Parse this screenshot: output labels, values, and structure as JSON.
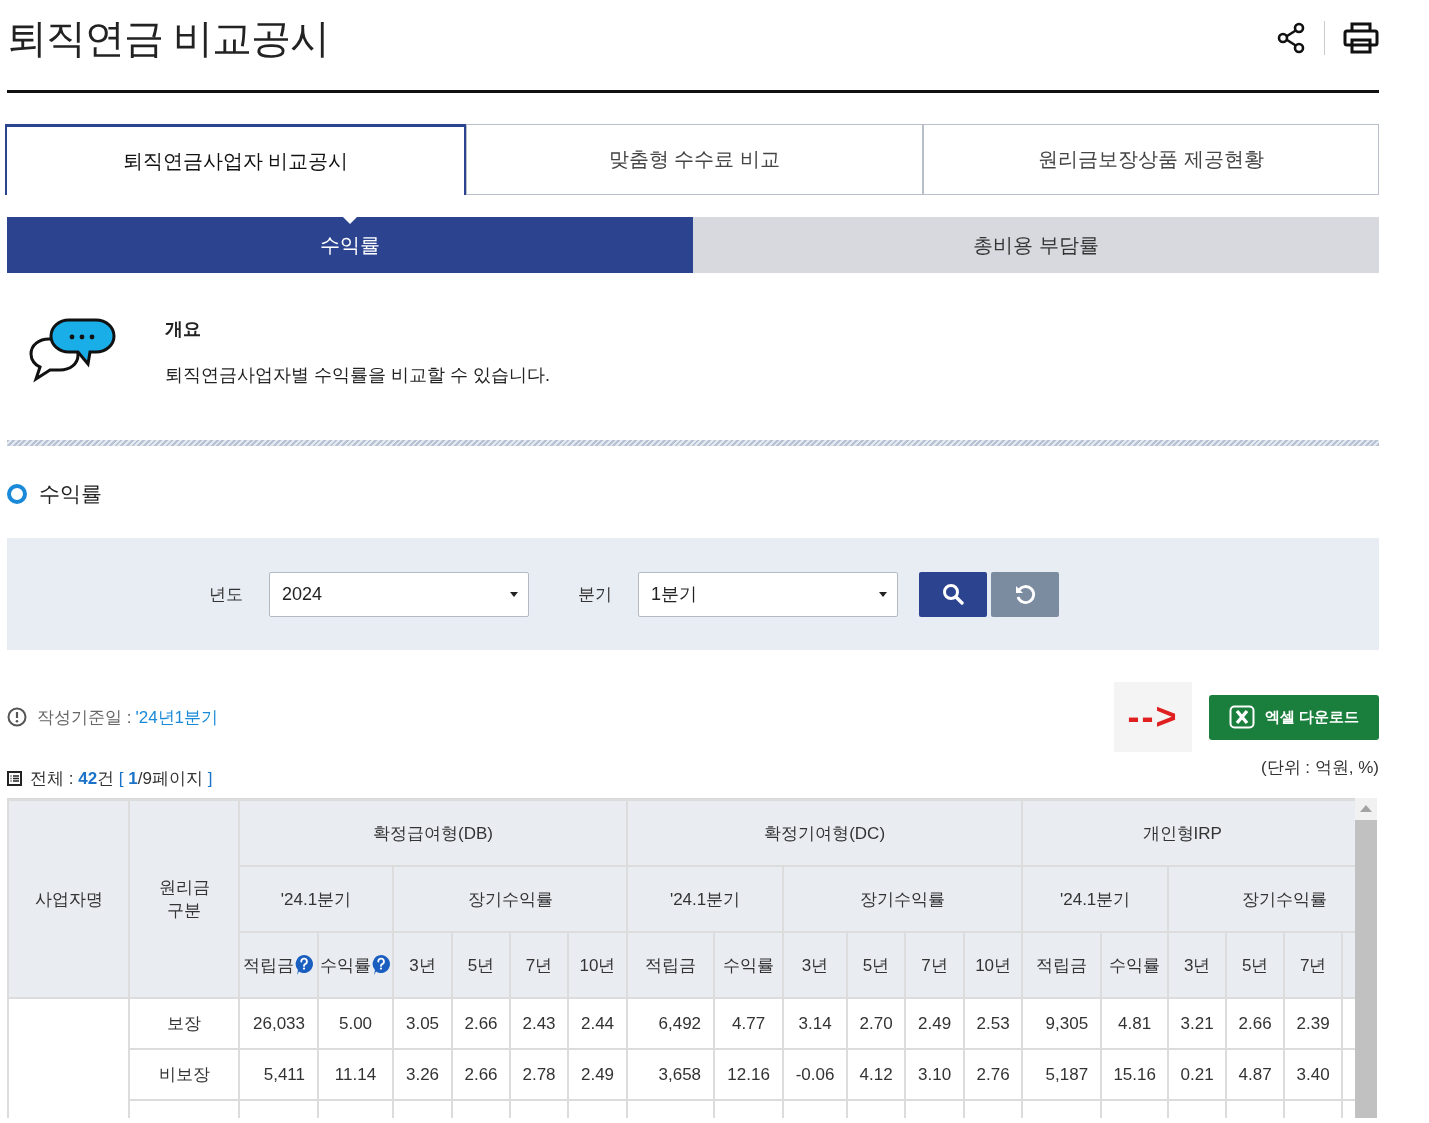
{
  "header": {
    "title": "퇴직연금 비교공시"
  },
  "tabs": [
    {
      "label": "퇴직연금사업자 비교공시",
      "selected": true
    },
    {
      "label": "맞춤형 수수료 비교",
      "selected": false
    },
    {
      "label": "원리금보장상품 제공현황",
      "selected": false
    }
  ],
  "subtabs": [
    {
      "label": "수익률",
      "selected": true
    },
    {
      "label": "총비용 부담률",
      "selected": false
    }
  ],
  "overview": {
    "heading": "개요",
    "description": "퇴직연금사업자별 수익률을 비교할 수 있습니다."
  },
  "section_title": "수익률",
  "search": {
    "fields": [
      {
        "label": "년도",
        "value": "2024"
      },
      {
        "label": "분기",
        "value": "1분기"
      }
    ]
  },
  "basis": {
    "label": "작성기준일 :",
    "value": "'24년1분기"
  },
  "annotation": "-->",
  "excel_button": "엑셀 다운로드",
  "summary": [
    {
      "text": "전체 : ",
      "kind": "plain"
    },
    {
      "text": "42",
      "kind": "strong"
    },
    {
      "text": "건 ",
      "kind": "plain"
    },
    {
      "text": "[ ",
      "kind": "accent"
    },
    {
      "text": "1",
      "kind": "strong"
    },
    {
      "text": "/9페이지 ",
      "kind": "plain"
    },
    {
      "text": "]",
      "kind": "accent"
    }
  ],
  "unit": "(단위 : 억원, %)",
  "table": {
    "corner": [
      "사업자명",
      "원리금 구분"
    ],
    "groups": [
      {
        "title": "확정급여형(DB)",
        "period": "'24.1분기",
        "long_term": "장기수익률",
        "columns": [
          {
            "label": "적립금",
            "help": true
          },
          {
            "label": "수익률",
            "help": true
          },
          {
            "label": "3년",
            "help": false
          },
          {
            "label": "5년",
            "help": false
          },
          {
            "label": "7년",
            "help": false
          },
          {
            "label": "10년",
            "help": false
          }
        ]
      },
      {
        "title": "확정기여형(DC)",
        "period": "'24.1분기",
        "long_term": "장기수익률",
        "columns": [
          {
            "label": "적립금",
            "help": false
          },
          {
            "label": "수익률",
            "help": false
          },
          {
            "label": "3년",
            "help": false
          },
          {
            "label": "5년",
            "help": false
          },
          {
            "label": "7년",
            "help": false
          },
          {
            "label": "10년",
            "help": false
          }
        ]
      },
      {
        "title": "개인형IRP",
        "period": "'24.1분기",
        "long_term": "장기수익률",
        "columns": [
          {
            "label": "적립금",
            "help": false
          },
          {
            "label": "수익률",
            "help": false
          },
          {
            "label": "3년",
            "help": false
          },
          {
            "label": "5년",
            "help": false
          },
          {
            "label": "7년",
            "help": false
          }
        ]
      }
    ],
    "rows": [
      {
        "type": "보장",
        "values": [
          "26,033",
          "5.00",
          "3.05",
          "2.66",
          "2.43",
          "2.44",
          "6,492",
          "4.77",
          "3.14",
          "2.70",
          "2.49",
          "2.53",
          "9,305",
          "4.81",
          "3.21",
          "2.66",
          "2.39"
        ]
      },
      {
        "type": "비보장",
        "values": [
          "5,411",
          "11.14",
          "3.26",
          "2.66",
          "2.78",
          "2.49",
          "3,658",
          "12.16",
          "-0.06",
          "4.12",
          "3.10",
          "2.76",
          "5,187",
          "15.16",
          "0.21",
          "4.87",
          "3.40"
        ]
      }
    ]
  }
}
